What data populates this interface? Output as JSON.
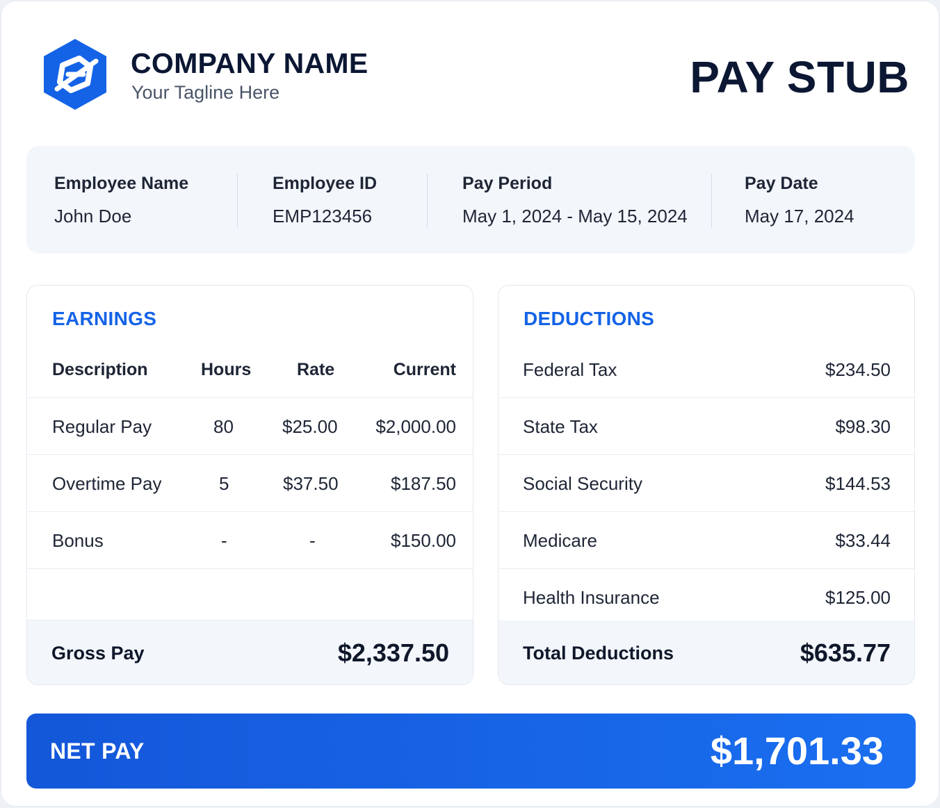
{
  "header": {
    "company_name": "COMPANY NAME",
    "tagline": "Your Tagline Here",
    "doc_title": "PAY STUB",
    "logo_icon": "hexagon-logo-icon"
  },
  "employee": {
    "name_label": "Employee Name",
    "name_value": "John Doe",
    "id_label": "Employee ID",
    "id_value": "EMP123456",
    "period_label": "Pay Period",
    "period_value": "May 1, 2024 - May 15, 2024",
    "date_label": "Pay Date",
    "date_value": "May 17, 2024"
  },
  "earnings": {
    "title": "EARNINGS",
    "columns": [
      "Description",
      "Hours",
      "Rate",
      "Current"
    ],
    "rows": [
      {
        "description": "Regular Pay",
        "hours": "80",
        "rate": "$25.00",
        "current": "$2,000.00"
      },
      {
        "description": "Overtime Pay",
        "hours": "5",
        "rate": "$37.50",
        "current": "$187.50"
      },
      {
        "description": "Bonus",
        "hours": "-",
        "rate": "-",
        "current": "$150.00"
      }
    ],
    "total_label": "Gross Pay",
    "total_value": "$2,337.50"
  },
  "deductions": {
    "title": "DEDUCTIONS",
    "rows": [
      {
        "label": "Federal Tax",
        "amount": "$234.50"
      },
      {
        "label": "State Tax",
        "amount": "$98.30"
      },
      {
        "label": "Social Security",
        "amount": "$144.53"
      },
      {
        "label": "Medicare",
        "amount": "$33.44"
      },
      {
        "label": "Health Insurance",
        "amount": "$125.00"
      }
    ],
    "total_label": "Total Deductions",
    "total_value": "$635.77"
  },
  "net_pay": {
    "label": "NET PAY",
    "value": "$1,701.33"
  },
  "colors": {
    "accent": "#1463E6",
    "net_bar": "#1A6FF0",
    "panel_bg": "#F3F6FB",
    "text_dark": "#0B1733"
  }
}
